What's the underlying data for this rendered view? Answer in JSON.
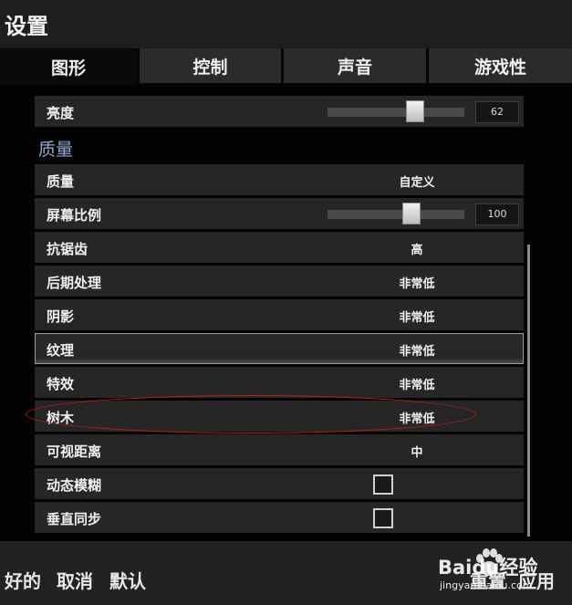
{
  "window": {
    "title": "设置"
  },
  "tabs": [
    {
      "label": "图形",
      "active": true
    },
    {
      "label": "控制",
      "active": false
    },
    {
      "label": "声音",
      "active": false
    },
    {
      "label": "游戏性",
      "active": false
    }
  ],
  "brightness": {
    "label": "亮度",
    "value": "62",
    "level": 0.62
  },
  "quality_section": {
    "header": "质量"
  },
  "rows": {
    "quality": {
      "label": "质量",
      "value": "自定义"
    },
    "screen_scale": {
      "label": "屏幕比例",
      "value": "100",
      "level": 0.62
    },
    "anti_aliasing": {
      "label": "抗锯齿",
      "value": "高"
    },
    "post_processing": {
      "label": "后期处理",
      "value": "非常低"
    },
    "shadows": {
      "label": "阴影",
      "value": "非常低"
    },
    "textures": {
      "label": "纹理",
      "value": "非常低"
    },
    "effects": {
      "label": "特效",
      "value": "非常低"
    },
    "foliage": {
      "label": "树木",
      "value": "非常低"
    },
    "view_distance": {
      "label": "可视距离",
      "value": "中"
    },
    "motion_blur": {
      "label": "动态模糊",
      "checked": false
    },
    "vsync": {
      "label": "垂直同步",
      "checked": false
    }
  },
  "footer": {
    "ok": "好的",
    "cancel": "取消",
    "default": "默认",
    "reset": "重置",
    "apply": "应用"
  },
  "watermark": {
    "brand": "Baidu经验",
    "site": "jingyan.baidu.com"
  },
  "colors": {
    "section_header": "#8aaad6",
    "annotation_ellipse": "#c81c1c"
  }
}
